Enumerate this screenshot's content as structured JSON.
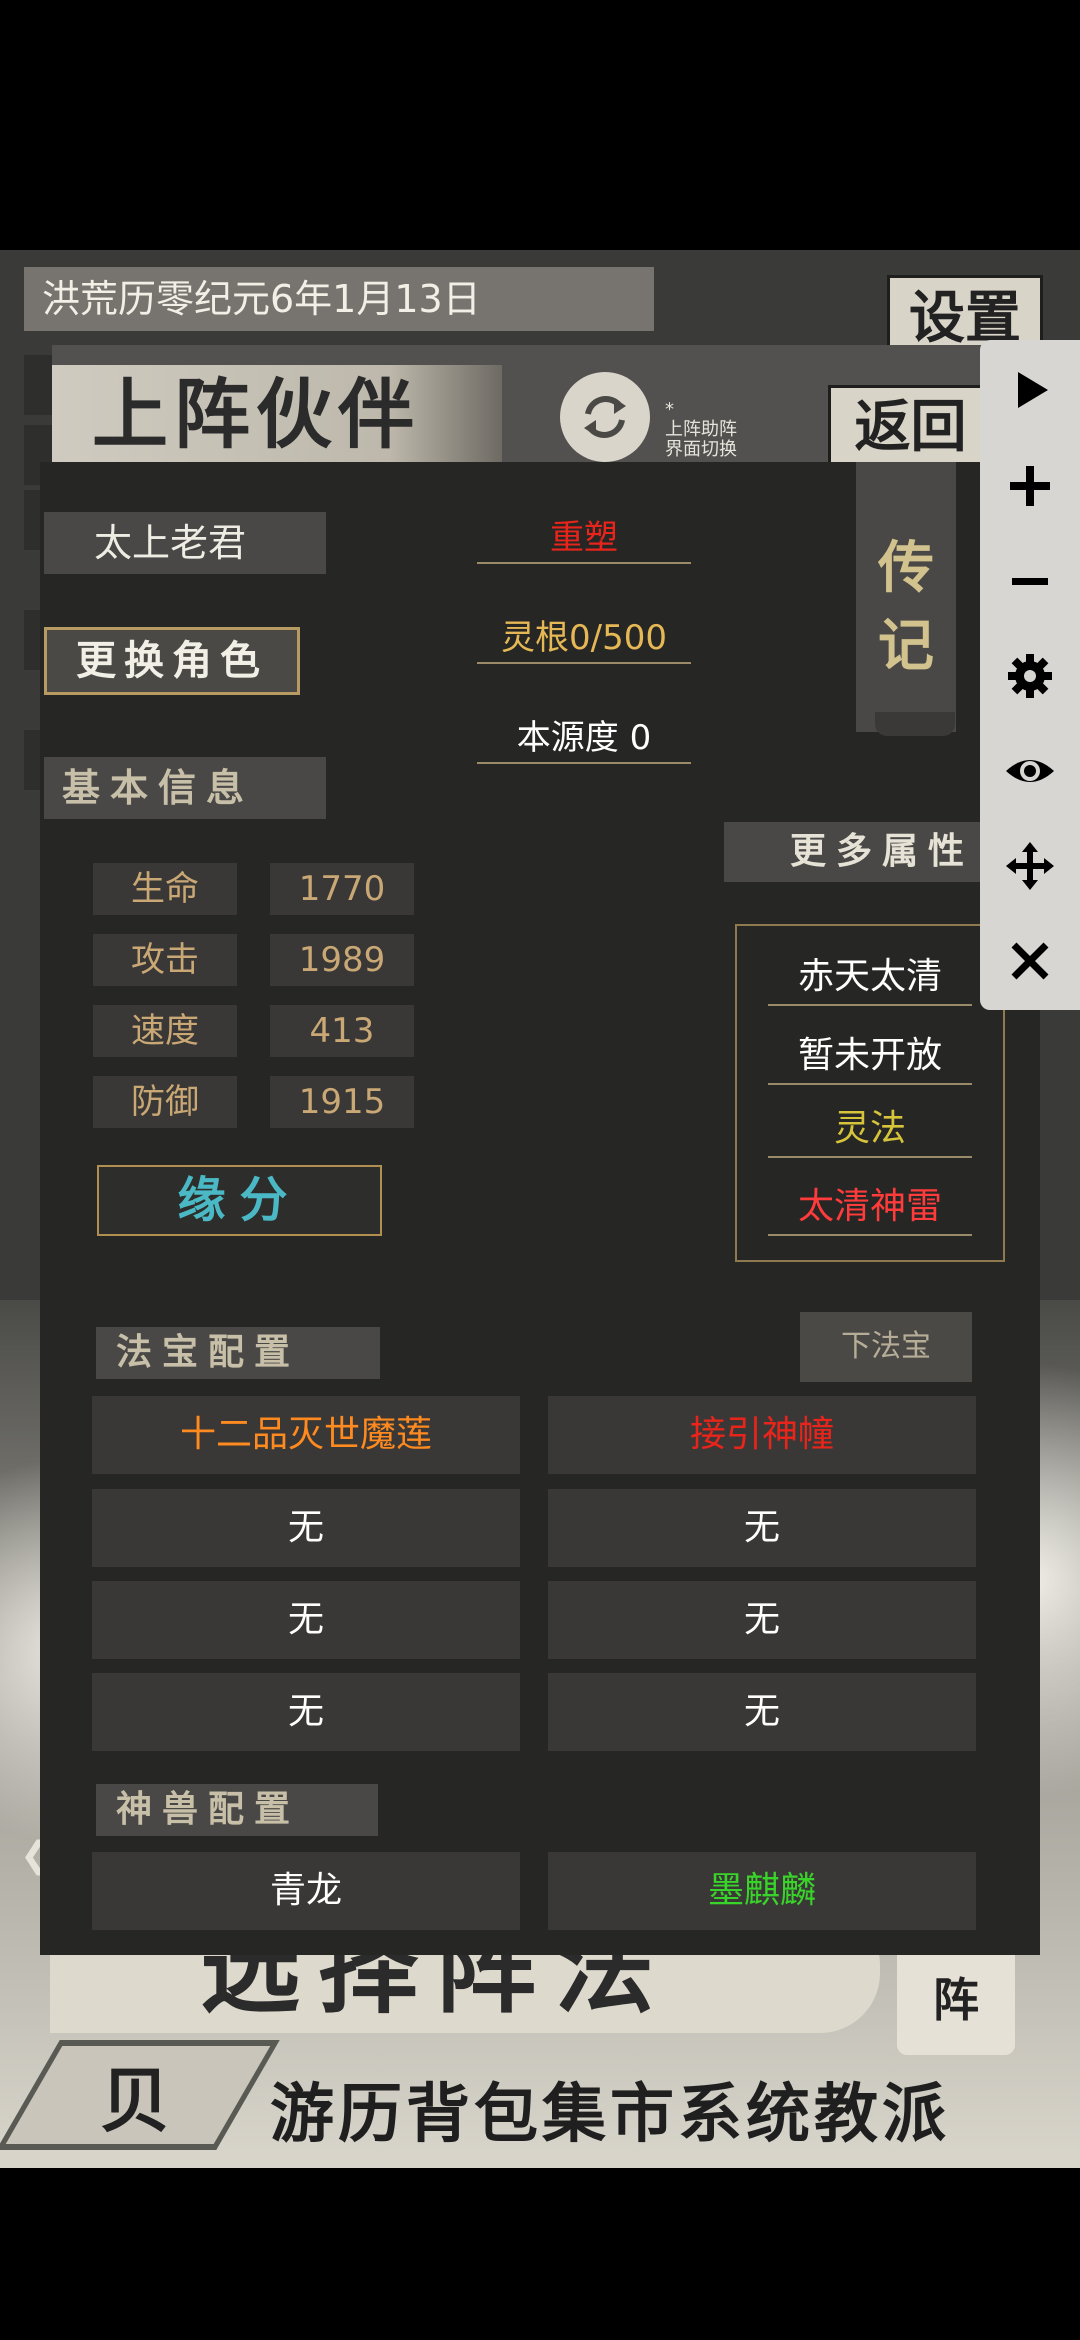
{
  "game": {
    "date": "洪荒历零纪元6年1月13日",
    "settings_label": "设置",
    "bottom_title": "选择阵法",
    "bottom_button": "阵",
    "bottom_nav": "游历背包集市系统教派",
    "emblem_char": "贝"
  },
  "header": {
    "title": "上阵伙伴",
    "switch_note_star": "*",
    "switch_note_line1": "上阵助阵",
    "switch_note_line2": "界面切换",
    "back_label": "返回"
  },
  "character": {
    "name": "太上老君",
    "change_label": "更换角色",
    "biography_label": "传记",
    "reshape_label": "重塑",
    "spirit_root": "灵根0/500",
    "origin_degree": "本源度 0"
  },
  "basic_info": {
    "header": "基本信息",
    "stats": [
      {
        "label": "生命",
        "value": "1770"
      },
      {
        "label": "攻击",
        "value": "1989"
      },
      {
        "label": "速度",
        "value": "413"
      },
      {
        "label": "防御",
        "value": "1915"
      }
    ],
    "fate_label": "缘分"
  },
  "attributes": {
    "more_label": "更多属性",
    "items": [
      {
        "label": "赤天太清",
        "color": "#ffffff"
      },
      {
        "label": "暂未开放",
        "color": "#ffffff"
      },
      {
        "label": "灵法",
        "color": "#d6c43a"
      },
      {
        "label": "太清神雷",
        "color": "#ff3b3b"
      }
    ]
  },
  "treasure": {
    "header": "法宝配置",
    "unequip_label": "下法宝",
    "slots": [
      {
        "name": "十二品灭世魔莲",
        "color": "#ff8a1f"
      },
      {
        "name": "接引神幢",
        "color": "#e8241b"
      },
      {
        "name": "无",
        "color": "#ffffff"
      },
      {
        "name": "无",
        "color": "#ffffff"
      },
      {
        "name": "无",
        "color": "#ffffff"
      },
      {
        "name": "无",
        "color": "#ffffff"
      },
      {
        "name": "无",
        "color": "#ffffff"
      },
      {
        "name": "无",
        "color": "#ffffff"
      }
    ]
  },
  "beast": {
    "header": "神兽配置",
    "slots": [
      {
        "name": "青龙",
        "color": "#ffffff"
      },
      {
        "name": "墨麒麟",
        "color": "#39d42a"
      }
    ]
  },
  "toolbar": {
    "icons": [
      "play-icon",
      "plus-icon",
      "minus-icon",
      "gear-icon",
      "eye-icon",
      "move-icon",
      "close-icon"
    ]
  },
  "colors": {
    "reshape": "#e8241b",
    "spirit_root": "#e6b855",
    "origin": "#ffffff",
    "fate": "#4bb9c5"
  }
}
